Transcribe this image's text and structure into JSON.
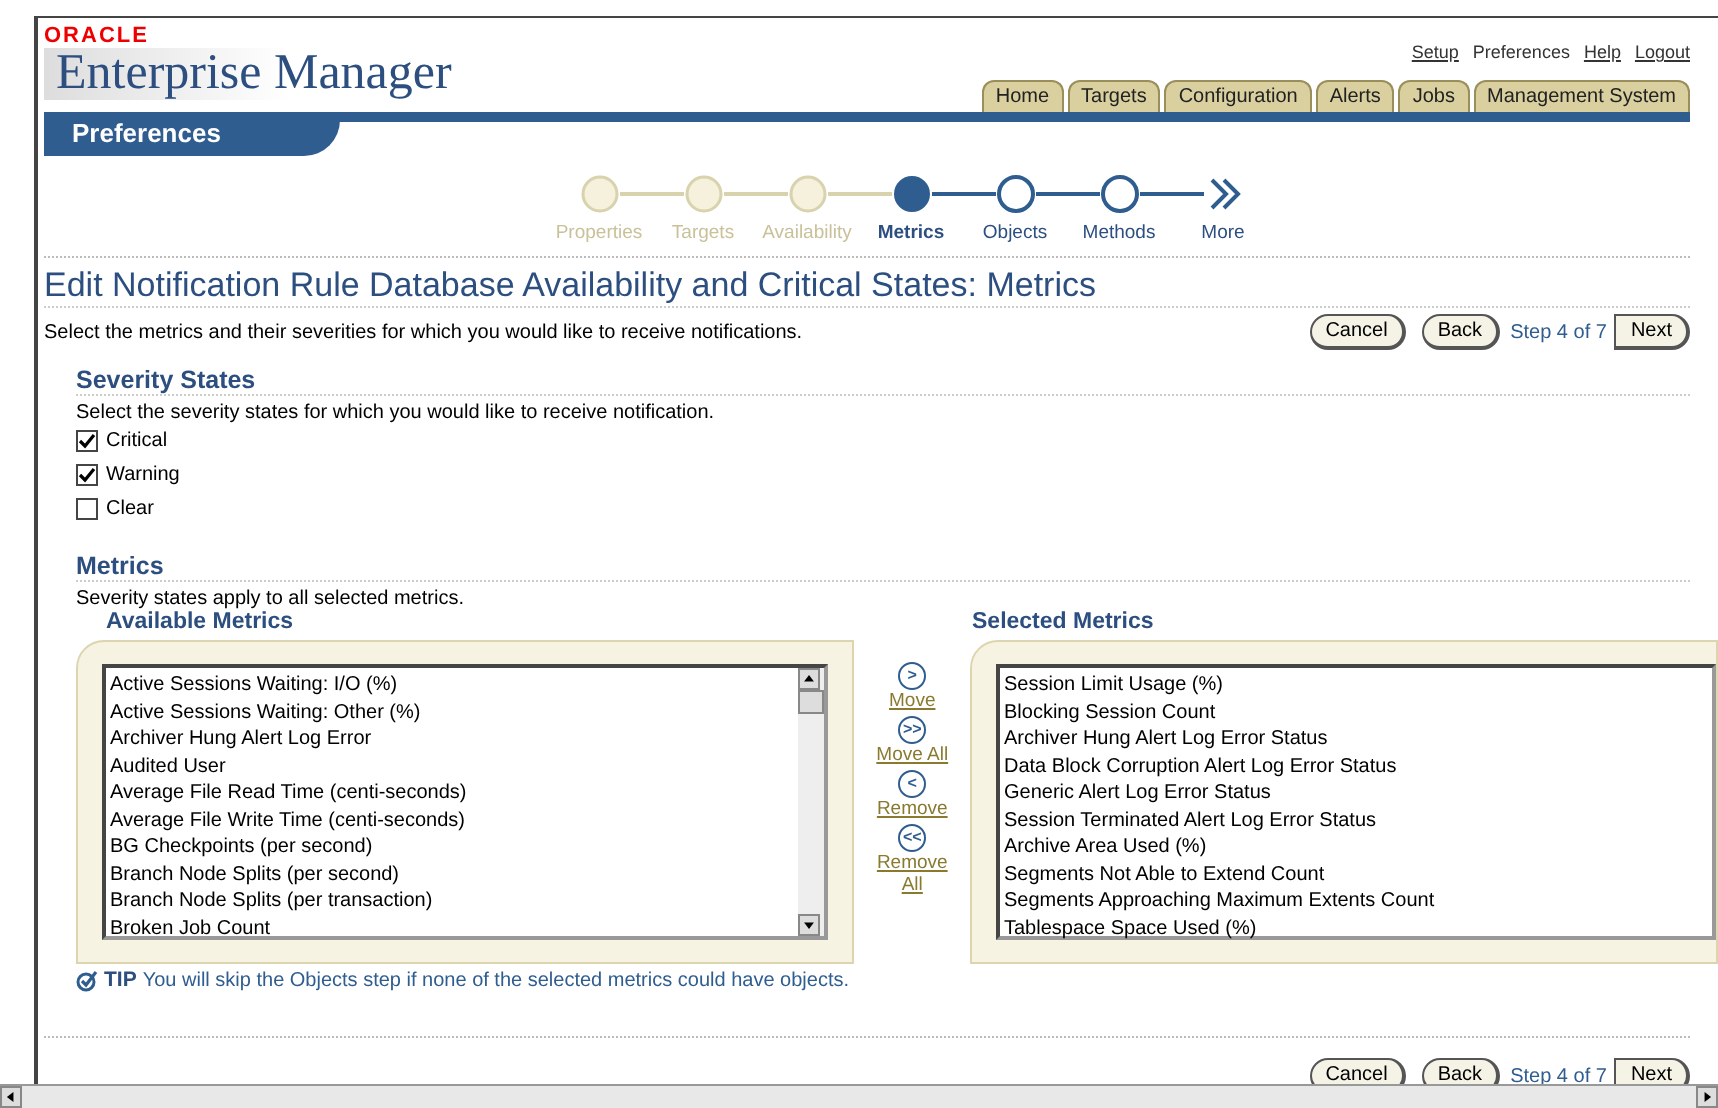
{
  "header": {
    "brand": "ORACLE",
    "product": "Enterprise Manager",
    "global_links": [
      "Setup",
      "Preferences",
      "Help",
      "Logout"
    ],
    "tabs": [
      {
        "label": "Home",
        "selected": false
      },
      {
        "label": "Targets",
        "selected": false
      },
      {
        "label": "Configuration",
        "selected": false
      },
      {
        "label": "Alerts",
        "selected": false
      },
      {
        "label": "Jobs",
        "selected": false
      },
      {
        "label": "Management System",
        "selected": false
      }
    ],
    "section_title": "Preferences"
  },
  "train": [
    {
      "label": "Properties",
      "kind": "step",
      "visited": true,
      "selected": false
    },
    {
      "label": "Targets",
      "kind": "step",
      "visited": true,
      "selected": false
    },
    {
      "label": "Availability",
      "kind": "step",
      "visited": true,
      "selected": false
    },
    {
      "label": "Metrics",
      "kind": "step",
      "visited": false,
      "selected": true
    },
    {
      "label": "Objects",
      "kind": "step",
      "visited": false,
      "selected": false
    },
    {
      "label": "Methods",
      "kind": "step",
      "visited": false,
      "selected": false
    },
    {
      "label": "More",
      "kind": "more",
      "visited": false,
      "selected": false
    }
  ],
  "page_title": "Edit Notification Rule Database Availability and Critical States: Metrics",
  "instructions": "Select the metrics and their severities for which you would like to receive notifications.",
  "nav_top": {
    "cancel": "Cancel",
    "back": "Back",
    "step": "Step 4 of 7",
    "next": "Next"
  },
  "severity": {
    "title": "Severity States",
    "hint": "Select the severity states for which you would like to receive notification.",
    "options": [
      {
        "label": "Critical",
        "checked": true
      },
      {
        "label": "Warning",
        "checked": true
      },
      {
        "label": "Clear",
        "checked": false
      }
    ]
  },
  "metrics": {
    "title": "Metrics",
    "hint": "Severity states apply to all selected metrics.",
    "available_title": "Available Metrics",
    "available": [
      "Active Sessions Waiting: I/O (%)",
      "Active Sessions Waiting: Other (%)",
      "Archiver Hung Alert Log Error",
      "Audited User",
      "Average File Read Time (centi-seconds)",
      "Average File Write Time (centi-seconds)",
      "BG Checkpoints (per second)",
      "Branch Node Splits (per second)",
      "Branch Node Splits (per transaction)",
      "Broken Job Count"
    ],
    "shuttle": [
      {
        "glyph": ">",
        "label": "Move"
      },
      {
        "glyph": ">>",
        "label": "Move All"
      },
      {
        "glyph": "<",
        "label": "Remove"
      },
      {
        "glyph": "<<",
        "label": "Remove All"
      }
    ],
    "selected_title": "Selected Metrics",
    "selected": [
      "Session Limit Usage (%)",
      "Blocking Session Count",
      "Archiver Hung Alert Log Error Status",
      "Data Block Corruption Alert Log Error Status",
      "Generic Alert Log Error Status",
      "Session Terminated Alert Log Error Status",
      "Archive Area Used (%)",
      "Segments Not Able to Extend Count",
      "Segments Approaching Maximum Extents Count",
      "Tablespace Space Used (%)"
    ]
  },
  "tip": {
    "label": "TIP",
    "text": "You will skip the Objects step if none of the selected metrics could have objects."
  },
  "nav_bottom": {
    "cancel": "Cancel",
    "back": "Back",
    "step": "Step 4 of 7",
    "next": "Next"
  }
}
